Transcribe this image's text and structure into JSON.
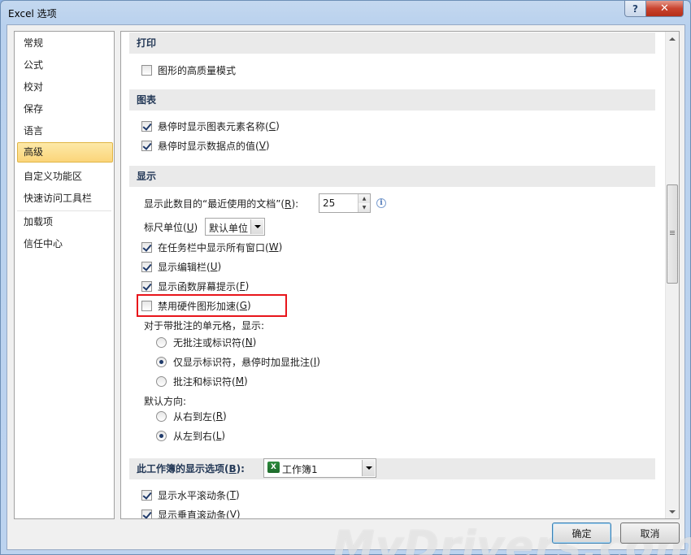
{
  "window": {
    "title": "Excel 选项",
    "help_label": "?",
    "close_label": "✕"
  },
  "nav": {
    "items": [
      {
        "label": "常规"
      },
      {
        "label": "公式"
      },
      {
        "label": "校对"
      },
      {
        "label": "保存"
      },
      {
        "label": "语言"
      },
      {
        "label": "高级"
      },
      {
        "label": "自定义功能区"
      },
      {
        "label": "快速访问工具栏"
      },
      {
        "label": "加载项"
      },
      {
        "label": "信任中心"
      }
    ],
    "selected": "高级"
  },
  "print": {
    "header": "打印",
    "hq_graphics": {
      "label": "图形的高质量模式",
      "checked": false
    }
  },
  "chart": {
    "header": "图表",
    "hover_names": {
      "label": "悬停时显示图表元素名称(",
      "hotkey": "C",
      "suffix": ")",
      "checked": true
    },
    "hover_values": {
      "label": "悬停时显示数据点的值(",
      "hotkey": "V",
      "suffix": ")",
      "checked": true
    }
  },
  "display": {
    "header": "显示",
    "recent_docs": {
      "label": "显示此数目的“最近使用的文档”(",
      "hotkey": "R",
      "suffix": "):",
      "value": "25"
    },
    "ruler_units": {
      "label": "标尺单位(",
      "hotkey": "U",
      "suffix": ")",
      "value": "默认单位"
    },
    "all_windows_taskbar": {
      "label": "在任务栏中显示所有窗口(",
      "hotkey": "W",
      "suffix": ")",
      "checked": true
    },
    "formula_bar": {
      "label": "显示编辑栏(",
      "hotkey": "U",
      "suffix": ")",
      "checked": true
    },
    "function_tips": {
      "label": "显示函数屏幕提示(",
      "hotkey": "F",
      "suffix": ")",
      "checked": true
    },
    "disable_hw_accel": {
      "label": "禁用硬件图形加速(",
      "hotkey": "G",
      "suffix": ")",
      "checked": false
    },
    "comments_label": "对于带批注的单元格，显示:",
    "comment_options": [
      {
        "label": "无批注或标识符(",
        "hotkey": "N",
        "suffix": ")",
        "checked": false
      },
      {
        "label": "仅显示标识符，悬停时加显批注(",
        "hotkey": "I",
        "suffix": ")",
        "checked": true
      },
      {
        "label": "批注和标识符(",
        "hotkey": "M",
        "suffix": ")",
        "checked": false
      }
    ],
    "direction_label": "默认方向:",
    "direction_options": [
      {
        "label": "从右到左(",
        "hotkey": "R",
        "suffix": ")",
        "checked": false
      },
      {
        "label": "从左到右(",
        "hotkey": "L",
        "suffix": ")",
        "checked": true
      }
    ]
  },
  "workbook": {
    "header": "此工作簿的显示选项(",
    "hotkey": "B",
    "suffix": "):",
    "value": "工作簿1",
    "icon_letter": "X",
    "h_scroll": {
      "label": "显示水平滚动条(",
      "hotkey": "T",
      "suffix": ")",
      "checked": true
    },
    "v_scroll": {
      "label": "显示垂直滚动条(",
      "hotkey": "V",
      "suffix": ")",
      "checked": true
    }
  },
  "buttons": {
    "ok": "确定",
    "cancel": "取消"
  },
  "watermark": "MyDrivers.com",
  "colors": {
    "highlight": "#e8151b",
    "selected_nav": "#fbd57a",
    "titlebar": "#c4d8ef"
  }
}
